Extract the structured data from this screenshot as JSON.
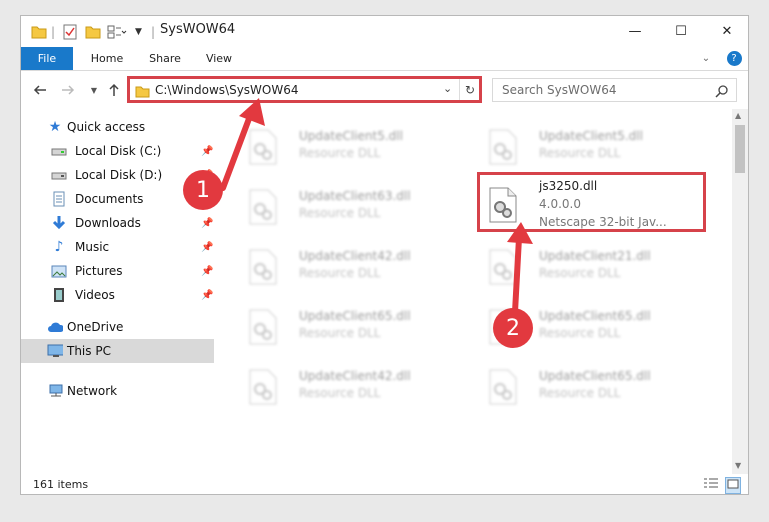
{
  "window": {
    "title": "SysWOW64",
    "minimize": "—",
    "maximize": "☐",
    "close": "✕"
  },
  "ribbon": {
    "tabs": [
      "File",
      "Home",
      "Share",
      "View"
    ],
    "help": "?"
  },
  "address": {
    "path": "C:\\Windows\\SysWOW64",
    "search_placeholder": "Search SysWOW64"
  },
  "sidebar": {
    "quick_access": "Quick access",
    "items": [
      {
        "label": "Local Disk (C:)",
        "pinned": true
      },
      {
        "label": "Local Disk (D:)",
        "pinned": true
      },
      {
        "label": "Documents",
        "pinned": true
      },
      {
        "label": "Downloads",
        "pinned": true
      },
      {
        "label": "Music",
        "pinned": true
      },
      {
        "label": "Pictures",
        "pinned": true
      },
      {
        "label": "Videos",
        "pinned": true
      }
    ],
    "onedrive": "OneDrive",
    "this_pc": "This PC",
    "network": "Network"
  },
  "files": {
    "left": [
      {
        "name": "UpdateClient5.dll",
        "type": "Resource DLL"
      },
      {
        "name": "UpdateClient63.dll",
        "type": "Resource DLL"
      },
      {
        "name": "UpdateClient42.dll",
        "type": "Resource DLL"
      },
      {
        "name": "UpdateClient65.dll",
        "type": "Resource DLL"
      },
      {
        "name": "UpdateClient42.dll",
        "type": "Resource DLL"
      }
    ],
    "right": [
      {
        "name": "UpdateClient5.dll",
        "type": "Resource DLL"
      },
      {
        "name": "js3250.dll",
        "version": "4.0.0.0",
        "type": "Netscape 32-bit Jav..."
      },
      {
        "name": "UpdateClient21.dll",
        "type": "Resource DLL"
      },
      {
        "name": "UpdateClient65.dll",
        "type": "Resource DLL"
      },
      {
        "name": "UpdateClient65.dll",
        "type": "Resource DLL"
      }
    ]
  },
  "status": {
    "count": "161 items"
  },
  "annotations": {
    "step1": "1",
    "step2": "2"
  },
  "colors": {
    "accent": "#1979ca",
    "highlight": "#d6424a",
    "badge": "#e2393f"
  }
}
